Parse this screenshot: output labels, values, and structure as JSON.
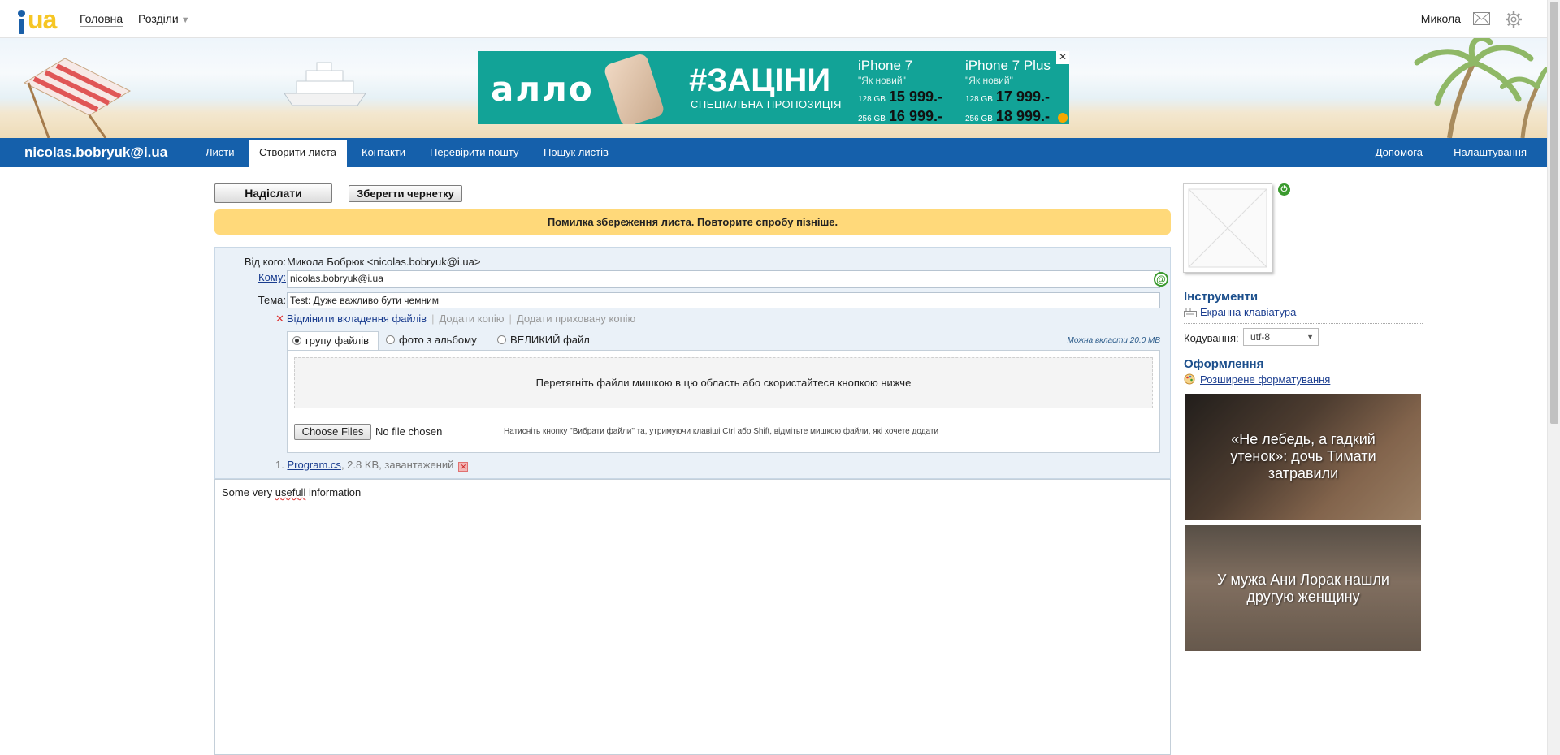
{
  "topbar": {
    "logo_text": "ua",
    "nav": {
      "home": "Головна",
      "sections": "Розділи",
      "sections_caret": "▼"
    },
    "user_name": "Микола"
  },
  "ad": {
    "logo": "аллo",
    "headline": "#ЗАЦІНИ",
    "subline": "СПЕЦІАЛЬНА ПРОПОЗИЦІЯ",
    "close": "✕",
    "offers": [
      {
        "model": "iPhone 7",
        "condition": "\"Як новий\"",
        "rows": [
          {
            "gb": "128 GB",
            "price": "15 999.-"
          },
          {
            "gb": "256 GB",
            "price": "16 999.-"
          }
        ]
      },
      {
        "model": "iPhone 7 Plus",
        "condition": "\"Як новий\"",
        "rows": [
          {
            "gb": "128 GB",
            "price": "17 999.-"
          },
          {
            "gb": "256 GB",
            "price": "18 999.-"
          }
        ]
      }
    ],
    "colors": {
      "bg": "#12a397"
    }
  },
  "mainnav": {
    "account": "nicolas.bobryuk@i.ua",
    "tabs": {
      "letters": "Листи",
      "compose": "Створити листа",
      "contacts": "Контакти",
      "check": "Перевірити пошту",
      "search": "Пошук листів"
    },
    "help": "Допомога",
    "settings": "Налаштування",
    "colors": {
      "bar": "#1560ab"
    }
  },
  "compose": {
    "send_label": "Надіслати",
    "draft_label": "Зберегти чернетку",
    "error_message": "Помилка збереження листа. Повторите спробу пізніше.",
    "from_label": "Від кого:",
    "from_value": "Микола Бобрюк <nicolas.bobryuk@i.ua>",
    "to_label": "Кому:",
    "to_value": "nicolas.bobryuk@i.ua",
    "subject_label": "Тема:",
    "subject_value": "Test: Дуже важливо бути чемним",
    "cancel_attach": "Відмінити вкладення файлів",
    "add_cc": "Додати копію",
    "add_bcc": "Додати приховану копію",
    "upload": {
      "tabs": {
        "group": "групу файлів",
        "album": "фото з альбому",
        "big": "ВЕЛИКИЙ файл"
      },
      "selected_tab": "групу файлів",
      "max_size": "Можна вкласти 20.0 MB",
      "dropzone": "Перетягніть файли мишкою в цю область або скористайтеся кнопкою нижче",
      "choose_files": "Choose Files",
      "no_file": "No file chosen",
      "hint": "Натисніть кнопку \"Вибрати файли\" та, утримуючи клавіші Ctrl або Shift, відмітьте мишкою файли, які хочете додати"
    },
    "attachment": {
      "index": "1.",
      "name": "Program.cs",
      "info": ", 2.8 KB, завантажений"
    },
    "body": {
      "before": "Some very ",
      "misspelled": "usefull",
      "after": " information"
    },
    "colors": {
      "error_bg": "#ffd97a",
      "form_bg": "#eaf1f8"
    }
  },
  "sidebar": {
    "tools_heading": "Інструменти",
    "keyboard_link": "Екранна клавіатура",
    "encoding_label": "Кодування:",
    "encoding_value": "utf-8",
    "design_heading": "Оформлення",
    "formatting_link": "Розширене форматування",
    "news": [
      {
        "text": "«Не лебедь, а гадкий утенок»: дочь Тимати затравили"
      },
      {
        "text": "У мужа Ани Лорак нашли другую женщину"
      }
    ]
  }
}
